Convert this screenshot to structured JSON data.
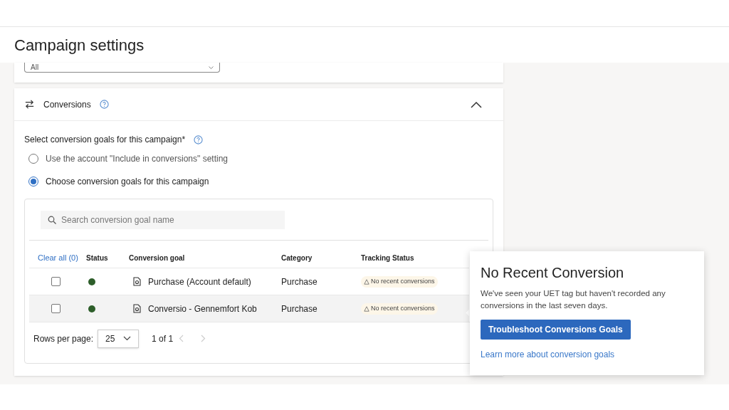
{
  "header": {
    "title": "Campaign settings"
  },
  "filter_dropdown": {
    "value": "All"
  },
  "section": {
    "title": "Conversions",
    "expanded": true,
    "question": "Select conversion goals for this campaign*",
    "options": [
      {
        "label": "Use the account \"Include in conversions\" setting",
        "selected": false
      },
      {
        "label": "Choose conversion goals for this campaign",
        "selected": true
      }
    ]
  },
  "table": {
    "search": {
      "placeholder": "Search conversion goal name"
    },
    "clear_all": "Clear all (0)",
    "columns": [
      "Status",
      "Conversion goal",
      "Category",
      "Tracking Status"
    ],
    "rows": [
      {
        "checked": false,
        "color": "#2d5e2a",
        "goal": "Purchase (Account default)",
        "category": "Purchase",
        "tracking": "No recent conversions",
        "highlighted": false
      },
      {
        "checked": false,
        "color": "#2d5e2a",
        "goal": "Conversio - Gennemfort Kob",
        "category": "Purchase",
        "tracking": "No recent conversions",
        "highlighted": true
      }
    ],
    "rows_per_page_label": "Rows per page:",
    "rows_per_page": "25",
    "page": "1 of 1"
  },
  "popover": {
    "title": "No Recent Conversion",
    "text": "We've seen your UET tag but haven't recorded any conversions in the last seven days.",
    "button": "Troubleshoot Conversions Goals",
    "link": "Learn more about conversion goals"
  }
}
